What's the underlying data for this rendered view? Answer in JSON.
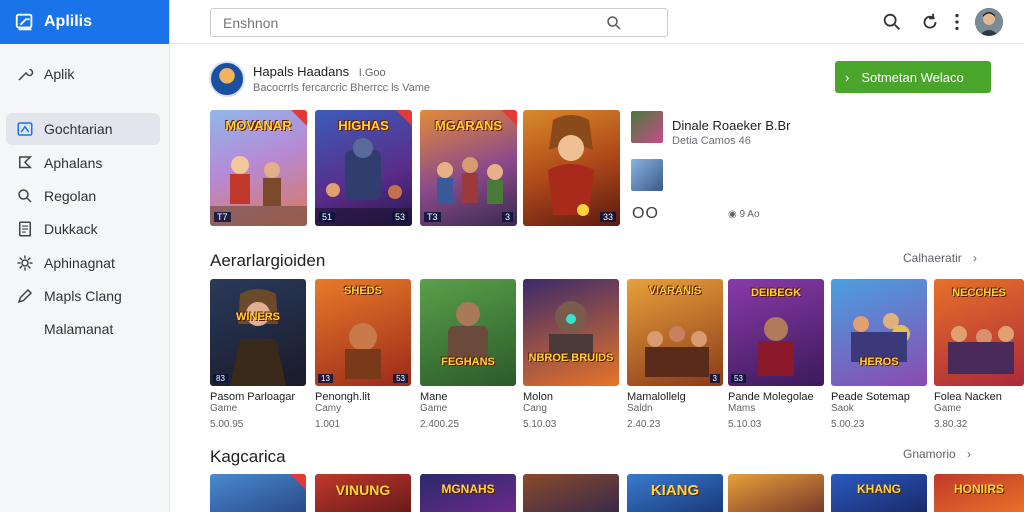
{
  "app": {
    "brand": "Aplilis"
  },
  "sidebar": {
    "items": [
      {
        "label": "Aplik",
        "icon": "wrench-icon"
      },
      {
        "label": "Gochtarian",
        "icon": "profile-card-icon"
      },
      {
        "label": "Aphalans",
        "icon": "flag-icon"
      },
      {
        "label": "Regolan",
        "icon": "search-icon"
      },
      {
        "label": "Dukkack",
        "icon": "document-icon"
      },
      {
        "label": "Aphinagnat",
        "icon": "gear-icon"
      },
      {
        "label": "Mapls Clang",
        "icon": "pen-icon"
      },
      {
        "label": "Malamanat",
        "icon": ""
      }
    ]
  },
  "search": {
    "placeholder": "Enshnon"
  },
  "featured": {
    "developer": "Hapals Haadans",
    "developer_meta": "I.Goo",
    "subtitle": "Bacocrrls fercarcric Bherrcc ls Vame",
    "cta": "Sotmetan Welaco",
    "thumbs": [
      {
        "title": "MOVANAR",
        "tag": "T7",
        "tag2": ""
      },
      {
        "title": "HIGHAS",
        "tag": "51",
        "tag2": "53"
      },
      {
        "title": "MGARANS",
        "tag": "T3",
        "tag2": "3"
      },
      {
        "title": "",
        "tag": "",
        "tag2": "33"
      }
    ],
    "app_name": "Dinale Roaeker B.Br",
    "app_category": "Detia Camos 46",
    "rating": "OO",
    "downloads": "9 Ao"
  },
  "sections": [
    {
      "title": "Aerarlargioiden",
      "see_all": "Calhaeratir",
      "cards": [
        {
          "logo": "WINERS",
          "name": "Pasom Parloagar",
          "category": "Game",
          "size": "5.00.95",
          "b1": "83",
          "b2": ""
        },
        {
          "logo": "SHEDS",
          "name": "Penongh.lit",
          "category": "Camy",
          "size": "1.001",
          "b1": "13",
          "b2": "53"
        },
        {
          "logo": "FEGHANS",
          "name": "Mane",
          "category": "Game",
          "size": "2.400.25",
          "b1": "",
          "b2": ""
        },
        {
          "logo": "NBROE BRUIDS",
          "name": "Molon",
          "category": "Cang",
          "size": "5.10.03",
          "b1": "",
          "b2": ""
        },
        {
          "logo": "VIARANIS",
          "name": "Mamalollelg",
          "category": "Saldn",
          "size": "2.40.23",
          "b1": "",
          "b2": "3"
        },
        {
          "logo": "DEIBEGK",
          "name": "Pande Molegolae",
          "category": "Mams",
          "size": "5.10.03",
          "b1": "53",
          "b2": ""
        },
        {
          "logo": "HEROS",
          "name": "Peade Sotemap",
          "category": "Saok",
          "size": "5.00.23",
          "b1": "",
          "b2": ""
        },
        {
          "logo": "NECCHES",
          "name": "Folea Nacken",
          "category": "Game",
          "size": "3.80.32",
          "b1": "",
          "b2": ""
        }
      ]
    },
    {
      "title": "Kagcarica",
      "see_all": "Gnamorio",
      "cards": [
        {
          "logo": ""
        },
        {
          "logo": "VINUNG"
        },
        {
          "logo": "MGNAHS"
        },
        {
          "logo": ""
        },
        {
          "logo": "KIANG"
        },
        {
          "logo": ""
        },
        {
          "logo": "KHANG"
        },
        {
          "logo": "HONIIRS"
        }
      ]
    }
  ],
  "colors": {
    "brand": "#1a73e8",
    "cta": "#4aa52b",
    "ribbon": "#e53935"
  }
}
